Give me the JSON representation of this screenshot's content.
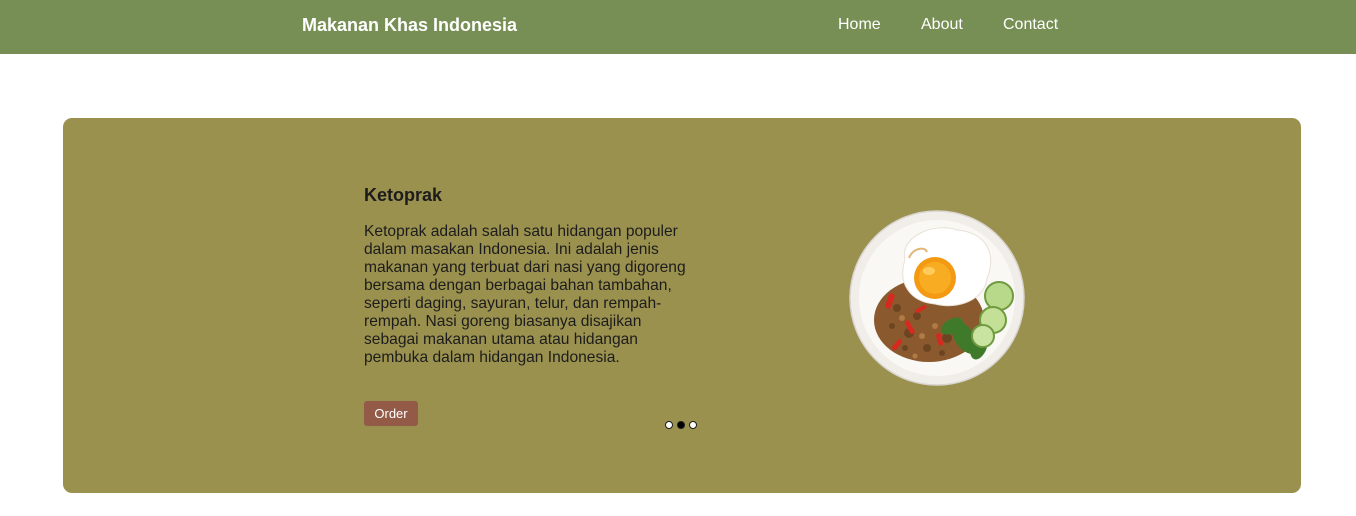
{
  "navbar": {
    "brand": "Makanan Khas Indonesia",
    "links": [
      "Home",
      "About",
      "Contact"
    ]
  },
  "slide": {
    "title": "Ketoprak",
    "description": "Ketoprak adalah salah satu hidangan populer dalam masakan Indonesia. Ini adalah jenis makanan yang terbuat dari nasi yang digoreng bersama dengan berbagai bahan tambahan, seperti daging, sayuran, telur, dan rempah-rempah. Nasi goreng biasanya disajikan sebagai makanan utama atau hidangan pembuka dalam hidangan Indonesia.",
    "button_label": "Order",
    "image_icon": "food-plate-icon"
  },
  "carousel": {
    "total": 3,
    "active_index": 1
  },
  "colors": {
    "navbar": "#778f55",
    "hero": "#9b914f",
    "button": "#935a48"
  }
}
